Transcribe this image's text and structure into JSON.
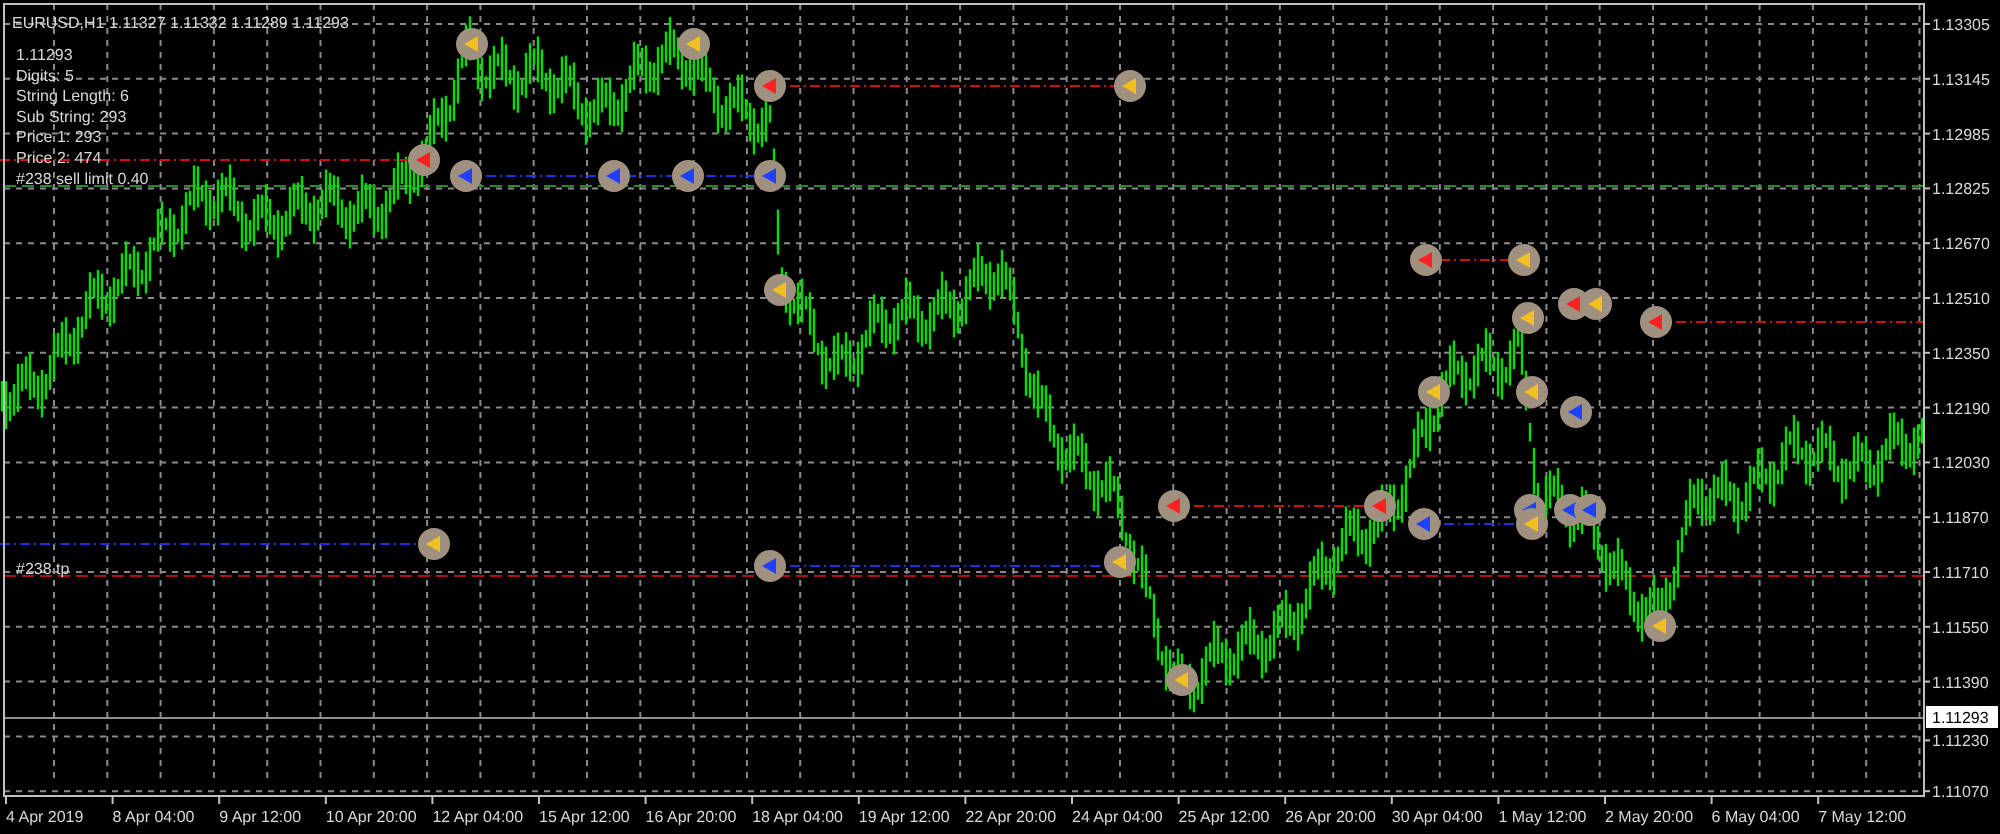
{
  "chart": {
    "header": "EURUSD,H1  1.11327 1.11332 1.11289 1.11293",
    "info_lines": [
      "1.11293",
      "Digits: 5",
      "String Length: 6",
      "Sub String: 293",
      "Price 1: 293",
      "Price 2: 474",
      "#238 sell limit 0.40"
    ],
    "order_label": "#238 tp",
    "price_axis": {
      "labels": [
        "1.13305",
        "1.13145",
        "1.12985",
        "1.12825",
        "1.12670",
        "1.12510",
        "1.12350",
        "1.12190",
        "1.12030",
        "1.11870",
        "1.11710",
        "1.11550",
        "1.11390",
        "1.11230",
        "1.11070"
      ],
      "current_price": "1.11293"
    },
    "time_axis": {
      "labels": [
        "4 Apr 2019",
        "8 Apr 04:00",
        "9 Apr 12:00",
        "10 Apr 20:00",
        "12 Apr 04:00",
        "15 Apr 12:00",
        "16 Apr 20:00",
        "18 Apr 04:00",
        "19 Apr 12:00",
        "22 Apr 20:00",
        "24 Apr 04:00",
        "25 Apr 12:00",
        "26 Apr 20:00",
        "30 Apr 04:00",
        "1 May 12:00",
        "2 May 20:00",
        "6 May 04:00",
        "7 May 12:00"
      ]
    }
  }
}
